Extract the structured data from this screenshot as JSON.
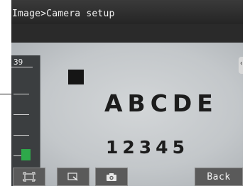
{
  "header": {
    "breadcrumb_parent": "Image",
    "breadcrumb_separator": ">",
    "breadcrumb_current": "Camera setup"
  },
  "meter": {
    "value": "39",
    "fill_fraction": 0.12,
    "accent_color": "#2ea84a"
  },
  "camera_view": {
    "letters": "ABCDE",
    "digits": "12345"
  },
  "side_tab": {
    "glyph": "‹"
  },
  "toolbar": {
    "buttons": [
      {
        "icon": "fit-frame-icon"
      },
      {
        "icon": "zoom-icon"
      },
      {
        "icon": "camera-icon"
      }
    ],
    "back_label": "Back"
  }
}
